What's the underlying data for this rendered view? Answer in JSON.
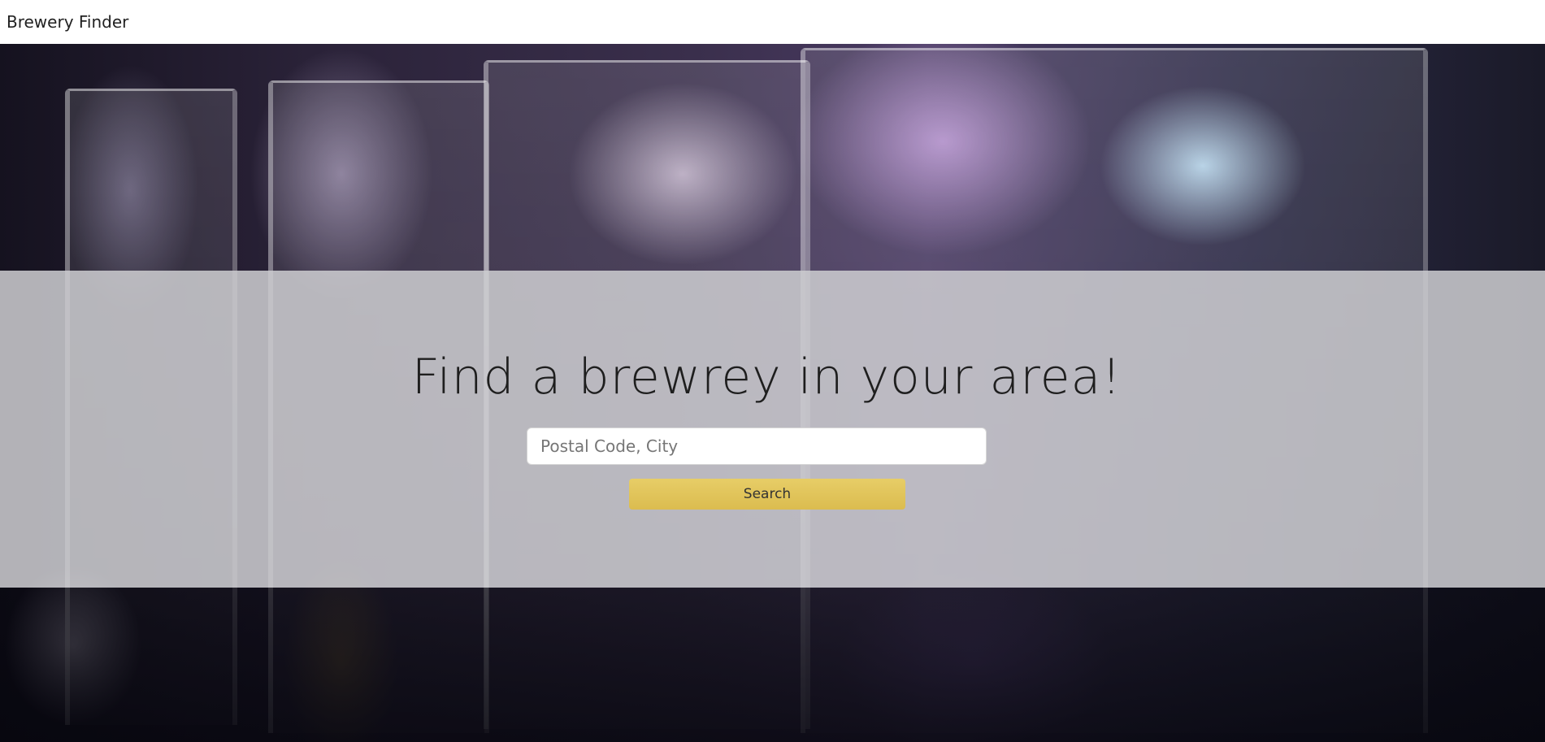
{
  "navbar": {
    "brand": "Brewery Finder"
  },
  "hero": {
    "background": "blurred photo of beer glasses",
    "headline": "Find a brewrey in your area!",
    "search": {
      "placeholder": "Postal Code, City",
      "value": "",
      "button_label": "Search"
    }
  },
  "colors": {
    "navbar_bg": "#ffffff",
    "overlay": "#cdcdd0",
    "button": "#e2c65c",
    "text": "#1e1e1e"
  }
}
